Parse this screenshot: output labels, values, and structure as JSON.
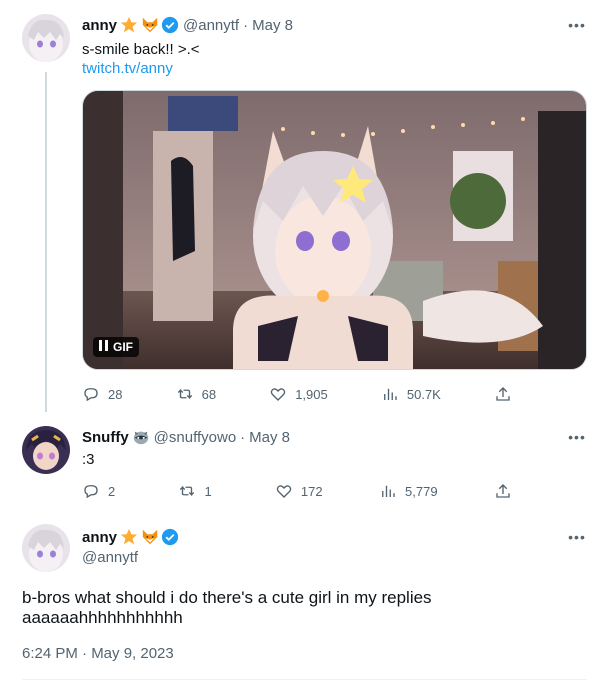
{
  "tweet1": {
    "name": "anny",
    "emojis": [
      "star-emoji",
      "fox-emoji"
    ],
    "handle": "@annytf",
    "date": "May 8",
    "text": "s-smile back!! >.<",
    "link": "twitch.tv/anny",
    "media_badge": "GIF",
    "stats": {
      "replies": "28",
      "retweets": "68",
      "likes": "1,905",
      "views": "50.7K"
    }
  },
  "tweet2": {
    "name": "Snuffy",
    "emojis": [
      "raccoon-emoji"
    ],
    "handle": "@snuffyowo",
    "date": "May 8",
    "text": ":3",
    "stats": {
      "replies": "2",
      "retweets": "1",
      "likes": "172",
      "views": "5,779"
    }
  },
  "main_tweet": {
    "name": "anny",
    "emojis": [
      "star-emoji",
      "fox-emoji"
    ],
    "handle": "@annytf",
    "text_line1": "b-bros what should i do there's a cute girl in my replies",
    "text_line2": "aaaaaahhhhhhhhhhh",
    "timestamp": "6:24 PM · May 9, 2023"
  },
  "colors": {
    "link": "#1d9bf0",
    "secondary": "#536471",
    "verified": "#1d9bf0"
  }
}
